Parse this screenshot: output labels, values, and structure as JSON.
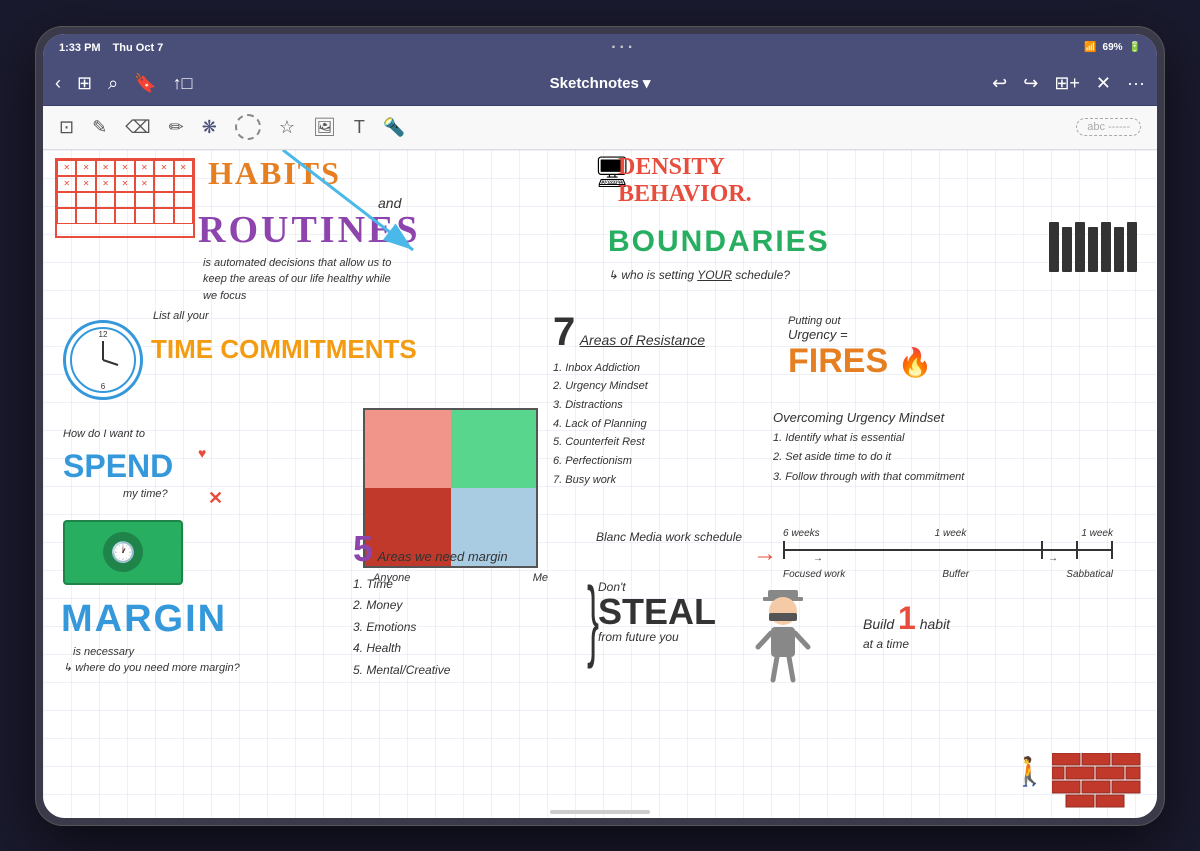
{
  "device": {
    "frame_color": "#3a3a4a"
  },
  "status_bar": {
    "time": "1:33 PM",
    "date": "Thu Oct 7",
    "wifi": "wifi",
    "battery": "69%"
  },
  "nav_bar": {
    "title": "Sketchnotes",
    "dropdown_icon": "▾"
  },
  "toolbar": {
    "tools": [
      "image",
      "pencil",
      "eraser",
      "highlighter",
      "shape",
      "lasso",
      "star",
      "photo",
      "text",
      "marker"
    ],
    "abc_label": "abc ------"
  },
  "content": {
    "habits_text": "HABITS",
    "and_text": "and",
    "routines_text": "RoutINES",
    "auto_text": "is automated decisions that allow us to keep the areas of our life healthy while we focus",
    "behavior_text": "DENSITY BEHAVIOR",
    "boundaries_text": "BOUNDARIES",
    "setting_text": "↳ who is setting YOUR schedule?",
    "list_all": "List all your",
    "time_commitments": "TIME COMMITMENTS",
    "seven_areas": {
      "num": "7",
      "label": "Areas of Resistance",
      "items": [
        "Inbox Addiction",
        "Urgency Mindset",
        "Distractions",
        "Lack of Planning",
        "Counterfeit Rest",
        "Perfectionism",
        "Busy work"
      ]
    },
    "urgency_label": "Putting out",
    "urgency_eq": "Urgency =",
    "fires_text": "FIRES",
    "overcoming": {
      "title": "Overcoming Urgency Mindset",
      "items": [
        "Identify what is essential",
        "Set aside time to do it",
        "Follow through with that commitment"
      ]
    },
    "spend_label": "How do I want to",
    "spend_text": "SPEND",
    "my_time": "my time?",
    "anyone_me": {
      "anyone": "Anyone",
      "me": "Me"
    },
    "five_areas": {
      "num": "5",
      "label": "Areas we need margin",
      "items": [
        "Time",
        "Money",
        "Emotions",
        "Health",
        "Mental/Creative"
      ]
    },
    "margin_text": "MARGIN",
    "margin_sub": "is necessary",
    "margin_q": "↳ where do you need more margin?",
    "dont_steal": {
      "dont": "Don't",
      "steal": "STEAL",
      "from": "from future you"
    },
    "blanc_media": {
      "text": "Blanc Media work schedule"
    },
    "timeline": {
      "label1": "6 weeks",
      "label2": "1 week",
      "label3": "1 week",
      "items": [
        "Focused work",
        "Buffer",
        "Sabbatical"
      ]
    },
    "build_habit": {
      "build": "Build",
      "num": "1",
      "habit": "habit",
      "at_a_time": "at a time"
    }
  }
}
